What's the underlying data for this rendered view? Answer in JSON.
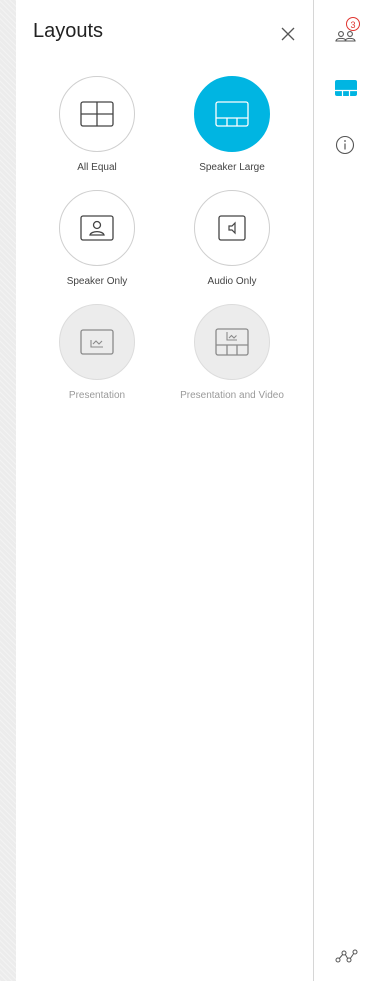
{
  "panel": {
    "title": "Layouts",
    "close_icon": "close-icon"
  },
  "layouts": [
    {
      "label": "All Equal",
      "icon": "grid-layout-icon",
      "state": "normal"
    },
    {
      "label": "Speaker Large",
      "icon": "speaker-large-layout-icon",
      "state": "selected"
    },
    {
      "label": "Speaker Only",
      "icon": "speaker-only-layout-icon",
      "state": "normal"
    },
    {
      "label": "Audio Only",
      "icon": "audio-only-layout-icon",
      "state": "normal"
    },
    {
      "label": "Presentation",
      "icon": "presentation-layout-icon",
      "state": "disabled"
    },
    {
      "label": "Presentation and Video",
      "icon": "presentation-video-layout-icon",
      "state": "disabled"
    }
  ],
  "rail": {
    "participants_count": "3",
    "participants_icon": "participants-icon",
    "layouts_icon": "layouts-icon",
    "info_icon": "info-icon",
    "stats_icon": "network-stats-icon"
  },
  "colors": {
    "accent": "#00b5e2",
    "badge": "#e0342f",
    "disabled_bg": "#ececec",
    "circle_border": "#cfcfcf"
  }
}
